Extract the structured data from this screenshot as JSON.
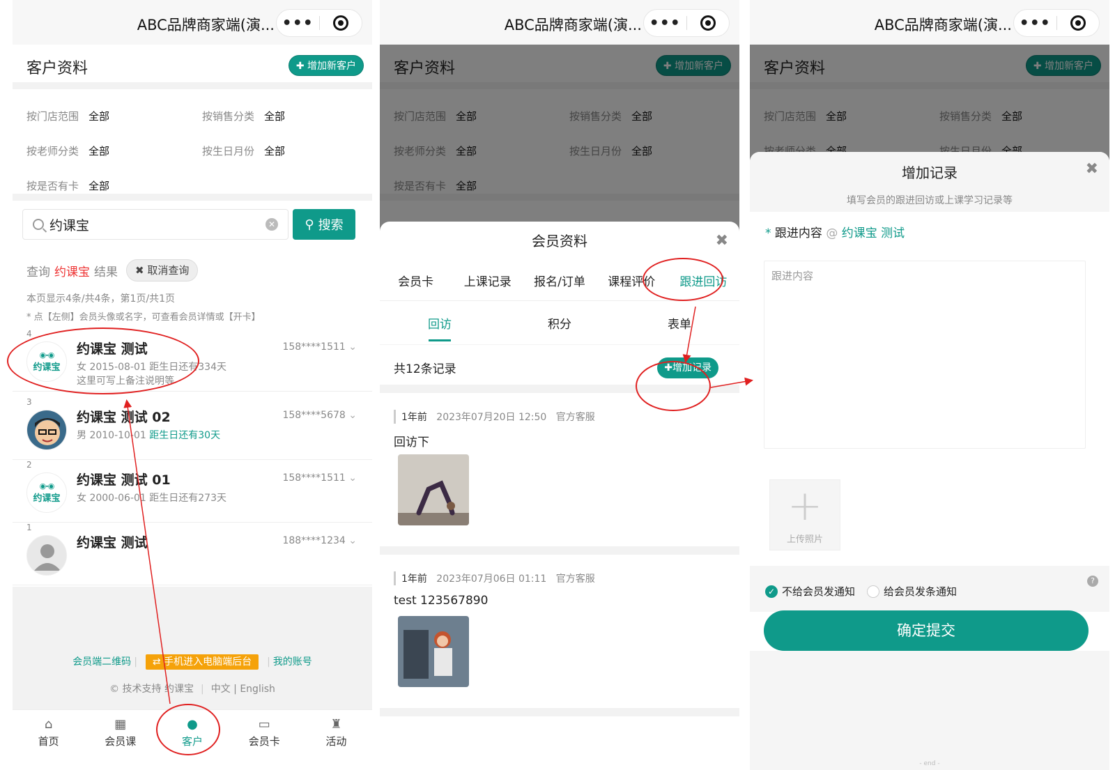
{
  "app_title": "ABC品牌商家端(演...",
  "capsule": {
    "more": "•••"
  },
  "page_header": {
    "title": "客户资料",
    "add_button": "✚ 增加新客户"
  },
  "filters": [
    {
      "label": "按门店范围",
      "value": "全部"
    },
    {
      "label": "按销售分类",
      "value": "全部"
    },
    {
      "label": "按老师分类",
      "value": "全部"
    },
    {
      "label": "按生日月份",
      "value": "全部"
    },
    {
      "label": "按是否有卡",
      "value": "全部"
    }
  ],
  "search": {
    "value": "约课宝",
    "button": "搜索"
  },
  "query": {
    "prefix": "查询",
    "keyword": "约课宝",
    "suffix": "结果",
    "cancel": "✖ 取消查询"
  },
  "page_info": "本页显示4条/共4条，第1页/共1页",
  "hint": "* 点【左侧】会员头像或名字，可查看会员详情或【开卡】",
  "members": [
    {
      "index": "4",
      "name": "约课宝 测试",
      "phone": "158****1511",
      "info": "女 2015-08-01 距生日还有334天",
      "note": "这里可写上备注说明等"
    },
    {
      "index": "3",
      "name": "约课宝 测试 02",
      "phone": "158****5678",
      "info_prefix": "男 2010-10-01 ",
      "info_highlight": "距生日还有30天"
    },
    {
      "index": "2",
      "name": "约课宝 测试 01",
      "phone": "158****1511",
      "info": "女 2000-06-01 距生日还有273天"
    },
    {
      "index": "1",
      "name": "约课宝 测试",
      "phone": "188****1234"
    }
  ],
  "logo_text": "约课宝",
  "footer": {
    "qr": "会员端二维码",
    "pc": "⇄ 手机进入电脑端后台",
    "account": "我的账号",
    "support": "© 技术支持 约课宝",
    "lang": "中文 | English"
  },
  "tabbar": [
    {
      "icon": "⌂",
      "label": "首页"
    },
    {
      "icon": "▦",
      "label": "会员课"
    },
    {
      "icon": "●",
      "label": "客户"
    },
    {
      "icon": "▭",
      "label": "会员卡"
    },
    {
      "icon": "♜",
      "label": "活动"
    }
  ],
  "member_sheet": {
    "title": "会员资料",
    "tabs": [
      "会员卡",
      "上课记录",
      "报名/订单",
      "课程评价",
      "跟进回访"
    ],
    "subtabs": [
      "回访",
      "积分",
      "表单"
    ],
    "count": "共12条记录",
    "add_record": "✚增加记录",
    "records": [
      {
        "ago": "1年前",
        "time": "2023年07月20日 12:50",
        "by": "官方客服",
        "text": "回访下"
      },
      {
        "ago": "1年前",
        "time": "2023年07月06日 01:11",
        "by": "官方客服",
        "text": "test 123567890"
      }
    ]
  },
  "add_sheet": {
    "title": "增加记录",
    "subtitle": "填写会员的跟进回访或上课学习记录等",
    "label_star": "*",
    "label": "跟进内容",
    "at": "@",
    "member": "约课宝 测试",
    "placeholder": "跟进内容",
    "upload": "上传照片",
    "no_notify": "不给会员发通知",
    "notify": "给会员发条通知",
    "submit": "确定提交",
    "end": "- end -"
  },
  "colors": {
    "accent": "#0f9a8a",
    "warn": "#f5a20a",
    "annotation": "#e02020"
  }
}
